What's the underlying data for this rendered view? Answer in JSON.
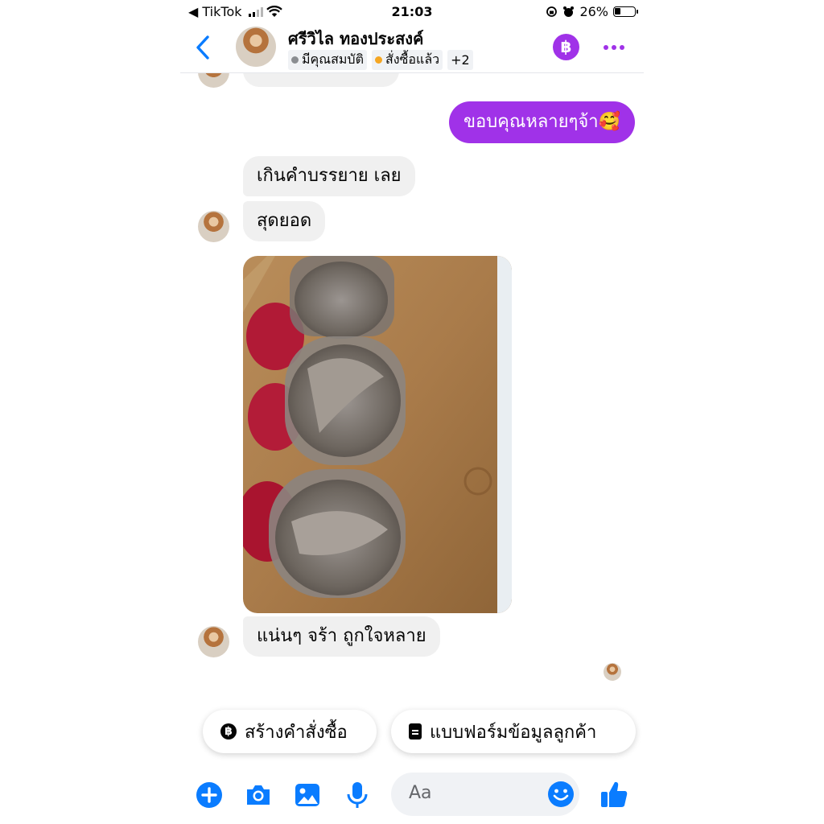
{
  "status_bar": {
    "back_app": "◀ TikTok",
    "time": "21:03",
    "battery": "26%"
  },
  "header": {
    "name": "ศรีวิไล ทองประสงค์",
    "tags": [
      {
        "label": "มีคุณสมบัติ",
        "color": "#8a8d91"
      },
      {
        "label": "สั่งซื้อแล้ว",
        "color": "#f5a623"
      }
    ],
    "more_tags": "+2",
    "baht_icon": "฿"
  },
  "messages": {
    "sent_1": "ขอบคุณหลายๆจ้า🥰",
    "recv_1": "เกินคำบรรยาย เลย",
    "recv_2": "สุดยอด",
    "recv_3": "แน่นๆ จร้า ถูกใจหลาย"
  },
  "quick_replies": {
    "create_order": "สร้างคำสั่งซื้อ",
    "customer_form": "แบบฟอร์มข้อมูลลูกค้า"
  },
  "composer": {
    "placeholder": "Aa"
  },
  "colors": {
    "accent": "#a032e8",
    "messenger_blue": "#0a7cff",
    "bubble": "#f0f0f0"
  },
  "icons": [
    "chevron-left-icon",
    "baht-icon",
    "more-icon",
    "plus-icon",
    "camera-icon",
    "image-icon",
    "microphone-icon",
    "emoji-icon",
    "thumbs-up-icon"
  ]
}
